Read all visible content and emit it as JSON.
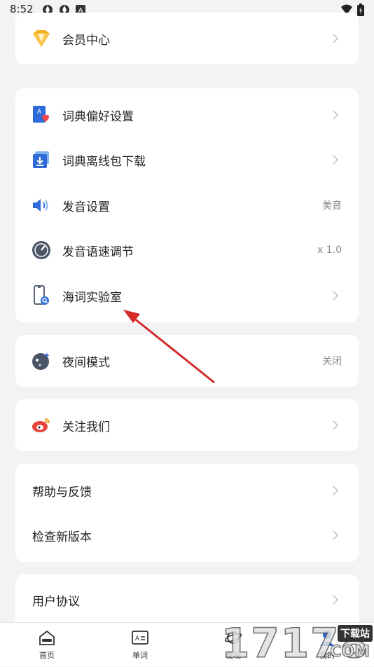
{
  "status_bar": {
    "time": "8:52",
    "icons": [
      "aperture-icon",
      "aperture-icon",
      "a-square-icon"
    ],
    "right_icons": [
      "wifi-icon",
      "battery-icon"
    ]
  },
  "membership": {
    "label": "会员中心",
    "icon": "vip-diamond-icon"
  },
  "settings": {
    "dict_prefs": {
      "label": "词典偏好设置",
      "icon": "dictionary-heart-icon"
    },
    "offline_download": {
      "label": "词典离线包下载",
      "icon": "download-box-icon"
    },
    "pronunciation": {
      "label": "发音设置",
      "value": "美音",
      "icon": "speaker-icon"
    },
    "speech_rate": {
      "label": "发音语速调节",
      "value": "x 1.0",
      "icon": "speedometer-icon"
    },
    "lab": {
      "label": "海词实验室",
      "icon": "phone-search-icon"
    }
  },
  "night_mode": {
    "label": "夜间模式",
    "value": "关闭",
    "icon": "moon-stars-icon"
  },
  "follow": {
    "label": "关注我们",
    "icon": "weibo-icon"
  },
  "support": {
    "help": {
      "label": "帮助与反馈"
    },
    "update": {
      "label": "检查新版本"
    }
  },
  "legal": {
    "agreement": {
      "label": "用户协议"
    }
  },
  "tabbar": {
    "tabs": [
      {
        "label": "首页",
        "icon": "home-icon"
      },
      {
        "label": "单词",
        "icon": "word-card-icon"
      },
      {
        "label": "发现",
        "icon": "planet-icon"
      },
      {
        "label": "我的",
        "icon": "user-icon"
      }
    ]
  },
  "watermark": {
    "number": "17178",
    "tag": "下载站",
    "suffix": ".COM"
  },
  "colors": {
    "background": "#f2f3f5",
    "card": "#ffffff",
    "arrow": "#d42a2a",
    "value_text": "#888888"
  }
}
